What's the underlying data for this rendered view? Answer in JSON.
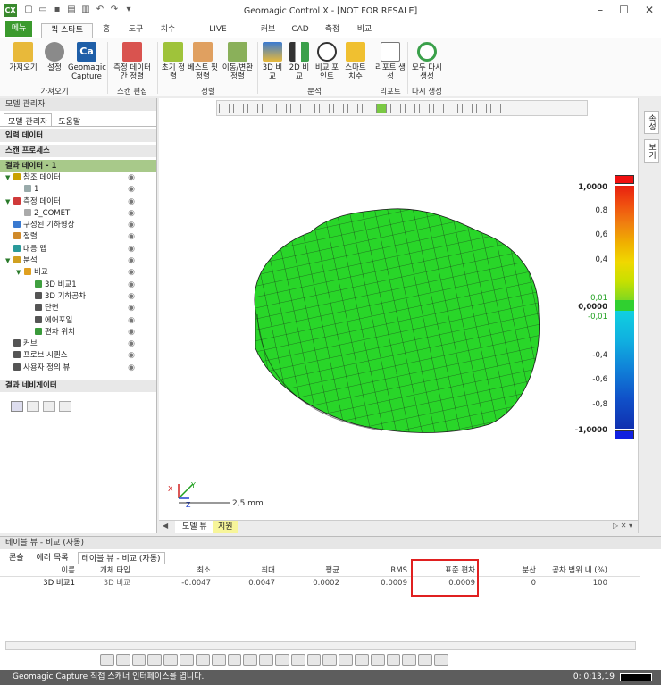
{
  "window": {
    "title": "Geomagic Control X - [NOT FOR RESALE]",
    "app_icon_label": "CX"
  },
  "ribbon_tabs": [
    "메뉴",
    "퀵 스타트",
    "홈",
    "도구",
    "치수",
    "LIVE CAPTURE",
    "커브",
    "CAD",
    "측정",
    "비교"
  ],
  "ribbon": {
    "buttons": [
      {
        "label": "가져오기",
        "icon": "import-folder-icon"
      },
      {
        "label": "설정",
        "icon": "settings-gear-icon"
      },
      {
        "label": "Geomagic Capture",
        "icon": "ca-capture-icon"
      },
      {
        "label": "측정 데이터 간 정렬",
        "icon": "data-align-icon"
      },
      {
        "label": "초기 정렬",
        "icon": "initial-align-icon"
      },
      {
        "label": "베스트 핏 정렬",
        "icon": "best-fit-icon"
      },
      {
        "label": "이동/변환 정렬",
        "icon": "move-transform-icon"
      },
      {
        "label": "3D 비교",
        "icon": "compare-3d-icon"
      },
      {
        "label": "2D 비교",
        "icon": "compare-2d-icon"
      },
      {
        "label": "비교 포인트",
        "icon": "compare-point-icon"
      },
      {
        "label": "스마트 치수",
        "icon": "smart-dimension-icon"
      },
      {
        "label": "리포트 생성",
        "icon": "report-icon"
      },
      {
        "label": "모두 다시 생성",
        "icon": "regenerate-icon"
      }
    ],
    "groups": [
      "가져오기",
      "스캔 편집",
      "정렬",
      "분석",
      "리포트",
      "다시 생성"
    ]
  },
  "left_panel": {
    "title": "모델 관리자",
    "tabs": [
      "모델 관리자",
      "도움말"
    ],
    "sections": {
      "input": "입력 데이터",
      "scan": "스캔 프로세스",
      "result": "결과 데이터 - 1",
      "nav": "결과 네비게이터"
    },
    "tree": [
      {
        "label": "참조 데이터",
        "indent": 0,
        "color": "#c9a100"
      },
      {
        "label": "1",
        "indent": 1,
        "color": "#9aa"
      },
      {
        "label": "측정 데이터",
        "indent": 0,
        "color": "#d03a3a"
      },
      {
        "label": "2_COMET",
        "indent": 1,
        "color": "#aaa"
      },
      {
        "label": "구성된 기하형상",
        "indent": 0,
        "color": "#3a7ad0"
      },
      {
        "label": "정렬",
        "indent": 0,
        "color": "#d08a2a"
      },
      {
        "label": "대응 맵",
        "indent": 0,
        "color": "#2a9a9a"
      },
      {
        "label": "분석",
        "indent": 0,
        "color": "#d0a020"
      },
      {
        "label": "비교",
        "indent": 1,
        "color": "#e0a020"
      },
      {
        "label": "3D 비교1",
        "indent": 2,
        "color": "#40a040"
      },
      {
        "label": "3D 기하공차",
        "indent": 2,
        "color": "#555"
      },
      {
        "label": "단면",
        "indent": 2,
        "color": "#555"
      },
      {
        "label": "에어포일",
        "indent": 2,
        "color": "#555"
      },
      {
        "label": "편차 위치",
        "indent": 2,
        "color": "#3a9a3a"
      },
      {
        "label": "커브",
        "indent": 0,
        "color": "#555"
      },
      {
        "label": "프로브 시퀀스",
        "indent": 0,
        "color": "#555"
      },
      {
        "label": "사용자 정의 뷰",
        "indent": 0,
        "color": "#555"
      }
    ]
  },
  "viewport": {
    "scale_labels": [
      "1,0000",
      "0,8",
      "0,6",
      "0,4",
      "0,01",
      "0,0000",
      "-0,01",
      "-0,4",
      "-0,6",
      "-0,8",
      "-1,0000"
    ],
    "scale_bar_text": "2,5 mm",
    "axis_labels": {
      "x": "X",
      "y": "Y",
      "z": "Z"
    },
    "tabs": [
      "모델 뷰",
      "지원"
    ]
  },
  "right_strip": {
    "items": [
      "속성",
      "보기"
    ]
  },
  "bottom_panel": {
    "title": "테이블 뷰 - 비교 (자동)",
    "tabs": [
      "콘솔",
      "에러 목록",
      "테이블 뷰 - 비교 (자동)"
    ],
    "columns": [
      "이름",
      "개체 타입",
      "최소",
      "최대",
      "평균",
      "RMS",
      "표준 편차",
      "분산",
      "공차 범위 내 (%)"
    ],
    "rows": [
      [
        "3D 비교1",
        "3D 비교",
        "-0.0047",
        "0.0047",
        "0.0002",
        "0.0009",
        "0.0009",
        "0",
        "100"
      ]
    ]
  },
  "status": {
    "message": "Geomagic Capture 직접 스캐너 인터페이스를 엽니다.",
    "time": "0: 0:13,19"
  }
}
